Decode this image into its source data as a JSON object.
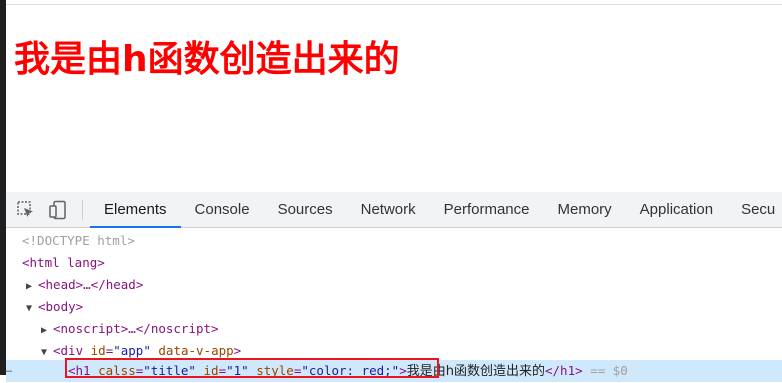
{
  "page": {
    "heading": "我是由h函数创造出来的"
  },
  "devtools": {
    "tabs": [
      "Elements",
      "Console",
      "Sources",
      "Network",
      "Performance",
      "Memory",
      "Application",
      "Secu"
    ],
    "dom": {
      "doctype": "<!DOCTYPE html>",
      "html_open": "<html lang>",
      "head": "<head>…</head>",
      "body_open": "<body>",
      "noscript": "<noscript>…</noscript>",
      "div_tag": "<div ",
      "div_attr1_name": "id",
      "div_attr1_val": "\"app\"",
      "div_attr2_name": "data-v-app",
      "div_close": ">",
      "h1_open": "<h1 ",
      "h1_attr1_name": "calss",
      "h1_attr1_val": "\"title\"",
      "h1_attr2_name": "id",
      "h1_attr2_val": "\"1\"",
      "h1_attr3_name": "style",
      "h1_attr3_val": "\"color: red;\"",
      "h1_gt": ">",
      "h1_text": "我是由h函数创造出来的",
      "h1_close": "</h1>",
      "h1_suffix": " == $0",
      "row_ellipsis": "…"
    }
  }
}
